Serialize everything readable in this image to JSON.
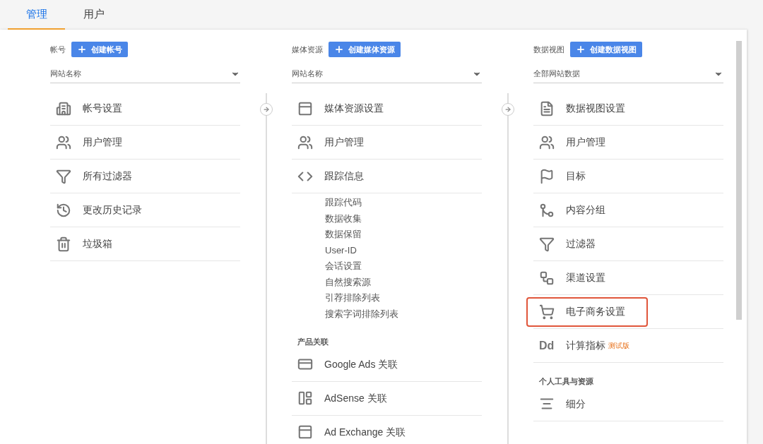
{
  "tabs": [
    {
      "label": "管理",
      "selected": true
    },
    {
      "label": "用户",
      "selected": false
    }
  ],
  "columns": [
    {
      "label": "帐号",
      "create_button": "创建帐号",
      "dropdown": {
        "value": "网站名称"
      },
      "sections": [
        {
          "items": [
            {
              "label": "帐号设置",
              "highlighted": false
            },
            {
              "label": "用户管理",
              "highlighted": false
            },
            {
              "label": "所有过滤器",
              "highlighted": false
            },
            {
              "label": "更改历史记录",
              "highlighted": false
            },
            {
              "label": "垃圾箱",
              "highlighted": false
            }
          ]
        }
      ]
    },
    {
      "label": "媒体资源",
      "create_button": "创建媒体资源",
      "dropdown": {
        "value": "网站名称"
      },
      "sections": [
        {
          "items": [
            {
              "label": "媒体资源设置",
              "highlighted": false
            },
            {
              "label": "用户管理",
              "highlighted": false
            },
            {
              "label": "跟踪信息",
              "highlighted": false,
              "children": [
                "跟踪代码",
                "数据收集",
                "数据保留",
                "User-ID",
                "会话设置",
                "自然搜索源",
                "引荐排除列表",
                "搜索字词排除列表"
              ]
            }
          ]
        },
        {
          "heading": "产品关联",
          "items": [
            {
              "label": "Google Ads 关联",
              "highlighted": false
            },
            {
              "label": "AdSense 关联",
              "highlighted": false
            },
            {
              "label": "Ad Exchange 关联",
              "highlighted": false
            }
          ]
        }
      ]
    },
    {
      "label": "数据视图",
      "create_button": "创建数据视图",
      "dropdown": {
        "value": "全部网站数据"
      },
      "sections": [
        {
          "items": [
            {
              "label": "数据视图设置",
              "highlighted": false
            },
            {
              "label": "用户管理",
              "highlighted": false
            },
            {
              "label": "目标",
              "highlighted": false
            },
            {
              "label": "内容分组",
              "highlighted": false
            },
            {
              "label": "过滤器",
              "highlighted": false
            },
            {
              "label": "渠道设置",
              "highlighted": false
            },
            {
              "label": "电子商务设置",
              "highlighted": true
            },
            {
              "label": "计算指标",
              "badge": "测试版",
              "icon_text": "Dd",
              "highlighted": false
            }
          ]
        },
        {
          "heading": "个人工具与资源",
          "items": [
            {
              "label": "细分",
              "highlighted": false
            }
          ]
        }
      ]
    }
  ]
}
